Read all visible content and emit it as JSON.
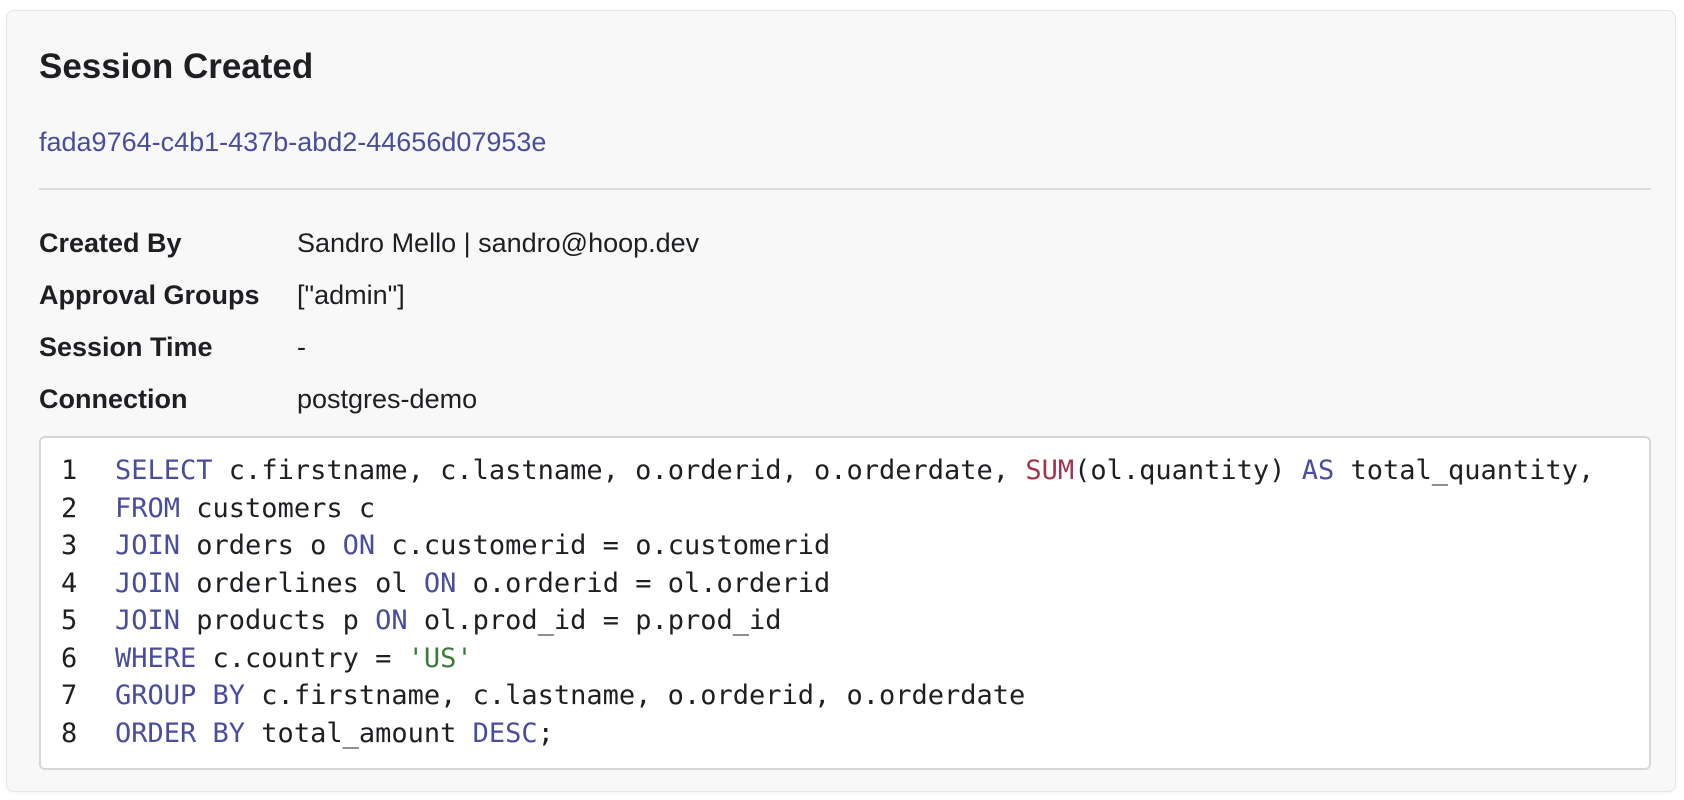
{
  "session": {
    "title": "Session Created",
    "id": "fada9764-c4b1-437b-abd2-44656d07953e"
  },
  "details": [
    {
      "label": "Created By",
      "value": "Sandro Mello | sandro@hoop.dev"
    },
    {
      "label": "Approval Groups",
      "value": "[\"admin\"]"
    },
    {
      "label": "Session Time",
      "value": "-"
    },
    {
      "label": "Connection",
      "value": "postgres-demo"
    }
  ],
  "colors": {
    "keyword": "#4a4c9c",
    "function": "#a3344f",
    "string": "#3a7a3a",
    "link": "#4a4c9c"
  },
  "code": {
    "lines": [
      {
        "number": "1",
        "tokens": [
          {
            "t": "kw",
            "v": "SELECT"
          },
          {
            "t": "plain",
            "v": " c.firstname, c.lastname, o.orderid, o.orderdate, "
          },
          {
            "t": "fn",
            "v": "SUM"
          },
          {
            "t": "plain",
            "v": "(ol.quantity) "
          },
          {
            "t": "kw",
            "v": "AS"
          },
          {
            "t": "plain",
            "v": " total_quantity,"
          }
        ]
      },
      {
        "number": "2",
        "tokens": [
          {
            "t": "kw",
            "v": "FROM"
          },
          {
            "t": "plain",
            "v": " customers c"
          }
        ]
      },
      {
        "number": "3",
        "tokens": [
          {
            "t": "kw",
            "v": "JOIN"
          },
          {
            "t": "plain",
            "v": " orders o "
          },
          {
            "t": "kw",
            "v": "ON"
          },
          {
            "t": "plain",
            "v": " c.customerid = o.customerid"
          }
        ]
      },
      {
        "number": "4",
        "tokens": [
          {
            "t": "kw",
            "v": "JOIN"
          },
          {
            "t": "plain",
            "v": " orderlines ol "
          },
          {
            "t": "kw",
            "v": "ON"
          },
          {
            "t": "plain",
            "v": " o.orderid = ol.orderid"
          }
        ]
      },
      {
        "number": "5",
        "tokens": [
          {
            "t": "kw",
            "v": "JOIN"
          },
          {
            "t": "plain",
            "v": " products p "
          },
          {
            "t": "kw",
            "v": "ON"
          },
          {
            "t": "plain",
            "v": " ol.prod_id = p.prod_id"
          }
        ]
      },
      {
        "number": "6",
        "tokens": [
          {
            "t": "kw",
            "v": "WHERE"
          },
          {
            "t": "plain",
            "v": " c.country = "
          },
          {
            "t": "str",
            "v": "'US'"
          }
        ]
      },
      {
        "number": "7",
        "tokens": [
          {
            "t": "kw",
            "v": "GROUP BY"
          },
          {
            "t": "plain",
            "v": " c.firstname, c.lastname, o.orderid, o.orderdate"
          }
        ]
      },
      {
        "number": "8",
        "tokens": [
          {
            "t": "kw",
            "v": "ORDER BY"
          },
          {
            "t": "plain",
            "v": " total_amount "
          },
          {
            "t": "kw",
            "v": "DESC"
          },
          {
            "t": "plain",
            "v": ";"
          }
        ]
      }
    ]
  }
}
